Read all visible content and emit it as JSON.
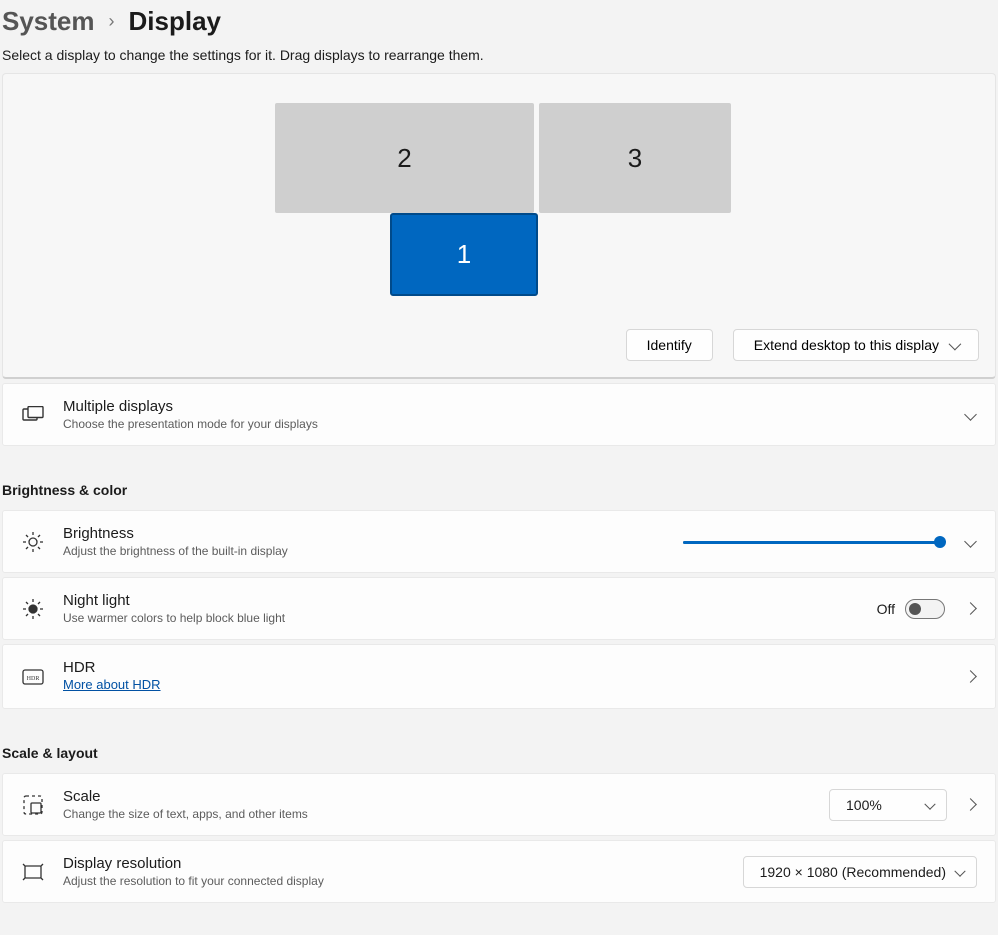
{
  "breadcrumb": {
    "parent": "System",
    "current": "Display"
  },
  "instruction": "Select a display to change the settings for it. Drag displays to rearrange them.",
  "monitors": {
    "one": "1",
    "two": "2",
    "three": "3"
  },
  "panel": {
    "identify": "Identify",
    "mode": "Extend desktop to this display"
  },
  "multiple_displays": {
    "title": "Multiple displays",
    "desc": "Choose the presentation mode for your displays"
  },
  "sections": {
    "brightness": "Brightness & color",
    "scale": "Scale & layout"
  },
  "brightness_row": {
    "title": "Brightness",
    "desc": "Adjust the brightness of the built-in display",
    "value_pct": 98
  },
  "night_light": {
    "title": "Night light",
    "desc": "Use warmer colors to help block blue light",
    "state": "Off"
  },
  "hdr": {
    "title": "HDR",
    "link": "More about HDR"
  },
  "scale_row": {
    "title": "Scale",
    "desc": "Change the size of text, apps, and other items",
    "value": "100%"
  },
  "resolution_row": {
    "title": "Display resolution",
    "desc": "Adjust the resolution to fit your connected display",
    "value": "1920 × 1080 (Recommended)"
  }
}
